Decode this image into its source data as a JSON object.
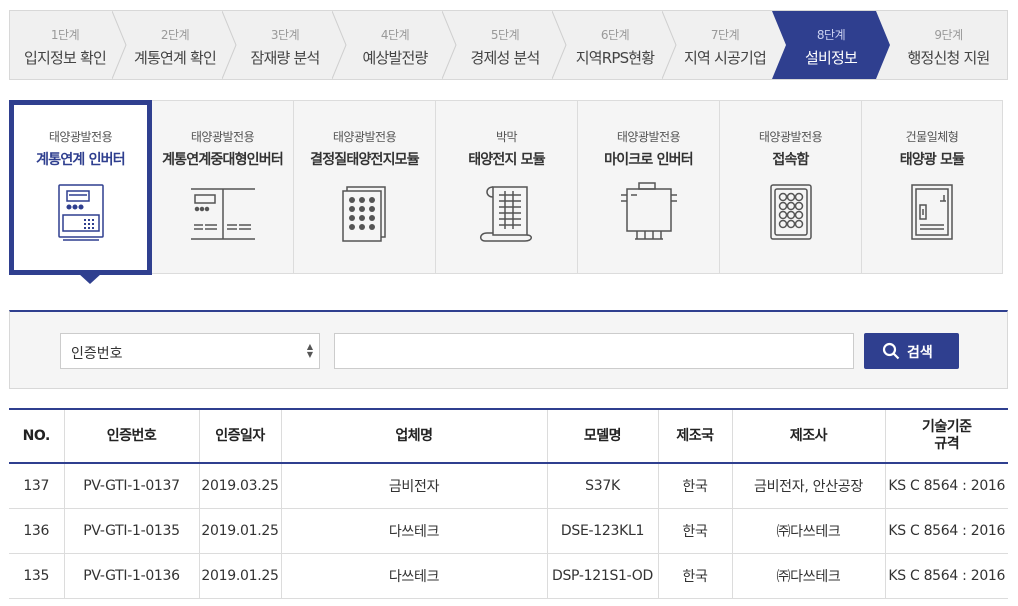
{
  "steps": [
    {
      "num": "1단계",
      "label": "입지정보 확인"
    },
    {
      "num": "2단계",
      "label": "계통연계 확인"
    },
    {
      "num": "3단계",
      "label": "잠재량 분석"
    },
    {
      "num": "4단계",
      "label": "예상발전량"
    },
    {
      "num": "5단계",
      "label": "경제성 분석"
    },
    {
      "num": "6단계",
      "label": "지역RPS현황"
    },
    {
      "num": "7단계",
      "label": "지역 시공기업"
    },
    {
      "num": "8단계",
      "label": "설비정보"
    },
    {
      "num": "9단계",
      "label": "행정신청 지원"
    }
  ],
  "active_step_index": 7,
  "categories": [
    {
      "sub": "태양광발전용",
      "main": "계통연계 인버터",
      "icon": "inverter-icon"
    },
    {
      "sub": "태양광발전용",
      "main": "계통연계중대형인버터",
      "icon": "large-inverter-icon"
    },
    {
      "sub": "태양광발전용",
      "main": "결정질태양전지모듈",
      "icon": "crystalline-module-icon"
    },
    {
      "sub": "박막",
      "main": "태양전지 모듈",
      "icon": "thin-film-module-icon"
    },
    {
      "sub": "태양광발전용",
      "main": "마이크로 인버터",
      "icon": "micro-inverter-icon"
    },
    {
      "sub": "태양광발전용",
      "main": "접속함",
      "icon": "junction-box-icon"
    },
    {
      "sub": "건물일체형",
      "main": "태양광 모듈",
      "icon": "bipv-module-icon"
    }
  ],
  "active_category_index": 0,
  "search": {
    "select_value": "인증번호",
    "input_value": "",
    "button_label": "검색"
  },
  "table": {
    "headers": [
      "NO.",
      "인증번호",
      "인증일자",
      "업체명",
      "모델명",
      "제조국",
      "제조사",
      "기술기준\n규격"
    ],
    "rows": [
      [
        "137",
        "PV-GTI-1-0137",
        "2019.03.25",
        "금비전자",
        "S37K",
        "한국",
        "금비전자, 안산공장",
        "KS C 8564 : 2016"
      ],
      [
        "136",
        "PV-GTI-1-0135",
        "2019.01.25",
        "다쓰테크",
        "DSE-123KL1",
        "한국",
        "㈜다쓰테크",
        "KS C 8564 : 2016"
      ],
      [
        "135",
        "PV-GTI-1-0136",
        "2019.01.25",
        "다쓰테크",
        "DSP-121S1-OD",
        "한국",
        "㈜다쓰테크",
        "KS C 8564 : 2016"
      ]
    ]
  },
  "colors": {
    "accent": "#2f3f8f",
    "bar_bg": "#f0f0f0",
    "border": "#dcdcdc"
  }
}
